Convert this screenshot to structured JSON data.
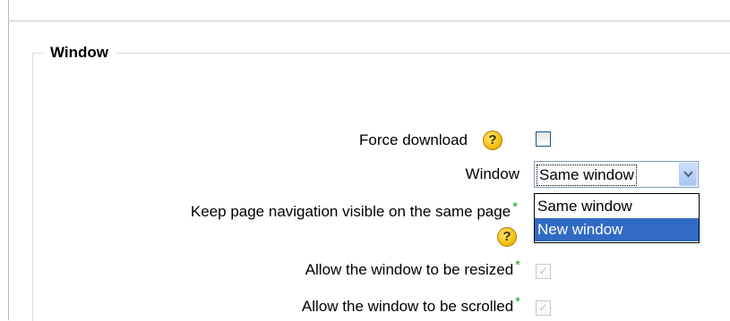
{
  "fieldset": {
    "legend": "Window"
  },
  "fields": {
    "force_download": {
      "label": "Force download",
      "help": "?"
    },
    "window": {
      "label": "Window",
      "selected_value": "Same window",
      "options": [
        "Same window",
        "New window"
      ],
      "highlighted_option": "New window"
    },
    "keep_nav": {
      "label": "Keep page navigation visible on the same page",
      "required_mark": "*",
      "help": "?"
    },
    "resizable": {
      "label": "Allow the window to be resized",
      "required_mark": "*",
      "check": "✓"
    },
    "scrollable": {
      "label": "Allow the window to be scrolled",
      "required_mark": "*",
      "check": "✓"
    }
  },
  "colors": {
    "required_mark": "#1ca11c",
    "selection_highlight": "#316ac5",
    "help_icon": "#f7c21a"
  },
  "icons": [
    "help-icon",
    "dropdown-arrow-icon",
    "checkmark-icon"
  ]
}
